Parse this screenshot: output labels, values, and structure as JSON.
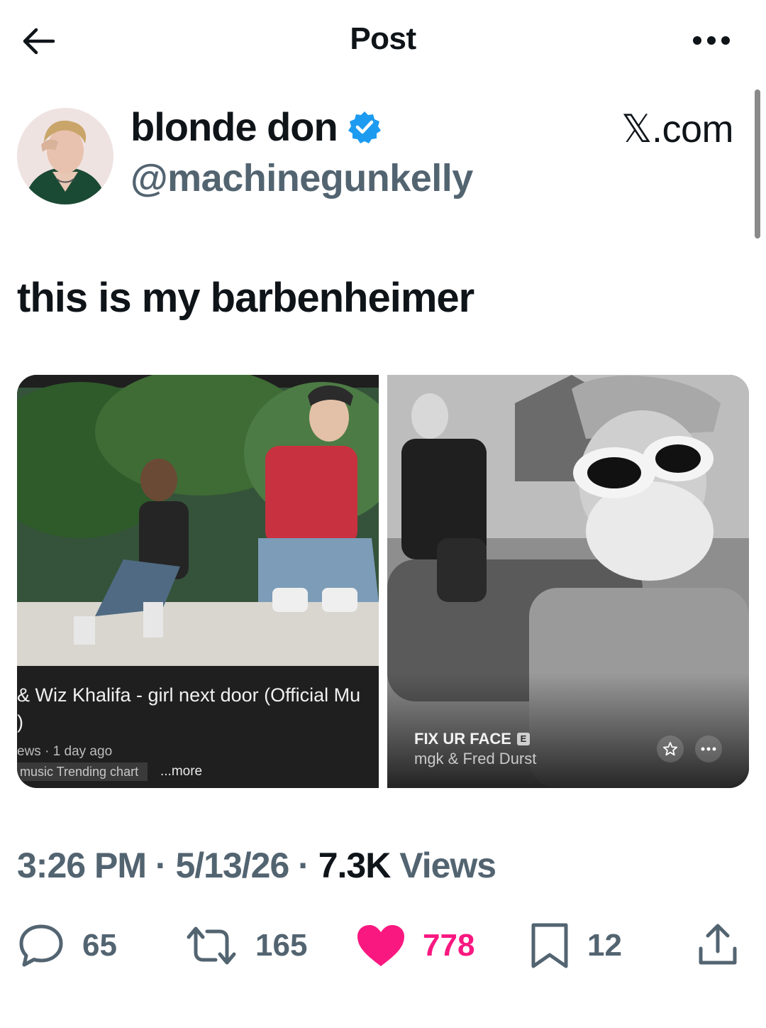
{
  "header": {
    "title": "Post",
    "back_icon": "arrow-left-icon",
    "more_icon": "ellipsis-horizontal-icon"
  },
  "author": {
    "display_name": "blonde don",
    "handle": "@machinegunkelly",
    "verified": true,
    "verified_color": "#1d9bf0"
  },
  "watermark": "𝕏.com",
  "tweet": {
    "text": "this is my barbenheimer"
  },
  "media": {
    "left": {
      "caption_line1": "& Wiz Khalifa - girl next door (Official Mu",
      "caption_line2": ")",
      "meta": "ews · 1 day ago",
      "chip": "music Trending chart",
      "more": "...more"
    },
    "right": {
      "song_title": "FIX UR FACE",
      "explicit_badge": "E",
      "artist": "mgk & Fred Durst"
    }
  },
  "meta": {
    "time": "3:26 PM",
    "separator": "·",
    "date": "5/13/26",
    "views_count": "7.3K",
    "views_label": "Views"
  },
  "actions": {
    "replies": "65",
    "reposts": "165",
    "likes": "778",
    "bookmarks": "12",
    "like_color": "#f91880",
    "muted_color": "#536471"
  }
}
